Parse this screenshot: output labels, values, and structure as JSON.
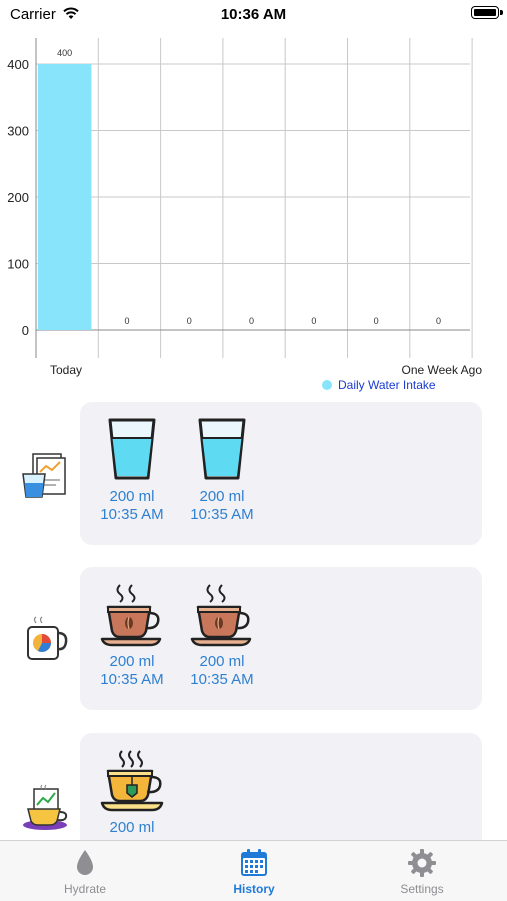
{
  "status_bar": {
    "carrier": "Carrier",
    "time": "10:36 AM"
  },
  "chart_data": {
    "type": "bar",
    "categories": [
      "Today",
      "",
      "",
      "",
      "",
      "",
      "One Week Ago"
    ],
    "tick_labels_x": [
      "Today",
      "One Week Ago"
    ],
    "series": [
      {
        "name": "Daily Water Intake",
        "values": [
          400,
          0,
          0,
          0,
          0,
          0,
          0
        ],
        "color": "#87e4fb"
      }
    ],
    "y_ticks": [
      0,
      100,
      200,
      300,
      400
    ],
    "ylim": [
      0,
      400
    ],
    "grid": true,
    "legend": "bottom-right"
  },
  "rows": [
    {
      "category_icon": "water-report-icon",
      "entries": [
        {
          "icon": "water-glass-icon",
          "amount": "200 ml",
          "time": "10:35 AM"
        },
        {
          "icon": "water-glass-icon",
          "amount": "200 ml",
          "time": "10:35 AM"
        }
      ]
    },
    {
      "category_icon": "coffee-mug-chart-icon",
      "entries": [
        {
          "icon": "coffee-cup-icon",
          "amount": "200 ml",
          "time": "10:35 AM"
        },
        {
          "icon": "coffee-cup-icon",
          "amount": "200 ml",
          "time": "10:35 AM"
        }
      ]
    },
    {
      "category_icon": "tea-report-icon",
      "entries": [
        {
          "icon": "tea-cup-icon",
          "amount": "200 ml",
          "time": ""
        }
      ]
    }
  ],
  "tabbar": {
    "tabs": [
      {
        "label": "Hydrate",
        "icon": "water-drop-icon",
        "active": false
      },
      {
        "label": "History",
        "icon": "calendar-icon",
        "active": true
      },
      {
        "label": "Settings",
        "icon": "gear-icon",
        "active": false
      }
    ],
    "active_color": "#1f7ad8",
    "inactive_color": "#8e8e93"
  }
}
